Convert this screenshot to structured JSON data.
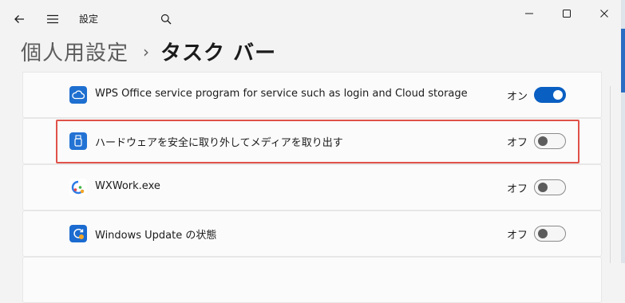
{
  "titlebar": {
    "app_title": "設定",
    "icons": [
      "back-arrow-icon",
      "hamburger-menu-icon",
      "search-icon",
      "minimize-icon",
      "maximize-icon",
      "close-icon"
    ]
  },
  "breadcrumb": {
    "parent": "個人用設定",
    "separator": "›",
    "current": "タスク バー"
  },
  "rows": [
    {
      "label": "WPS Office service program for service such as login and Cloud storage",
      "state": "オン",
      "on": true,
      "icon": "wps-cloud-icon"
    },
    {
      "label": "ハードウェアを安全に取り外してメディアを取り出す",
      "state": "オフ",
      "on": false,
      "icon": "usb-eject-icon",
      "highlighted": true
    },
    {
      "label": "WXWork.exe",
      "state": "オフ",
      "on": false,
      "icon": "wxwork-icon"
    },
    {
      "label": "Windows Update の状態",
      "state": "オフ",
      "on": false,
      "icon": "windows-update-icon"
    }
  ],
  "colors": {
    "accent": "#0a5fc2",
    "highlight_border": "#e0524a",
    "background": "#f3f3f3",
    "card": "#fbfbfb"
  }
}
